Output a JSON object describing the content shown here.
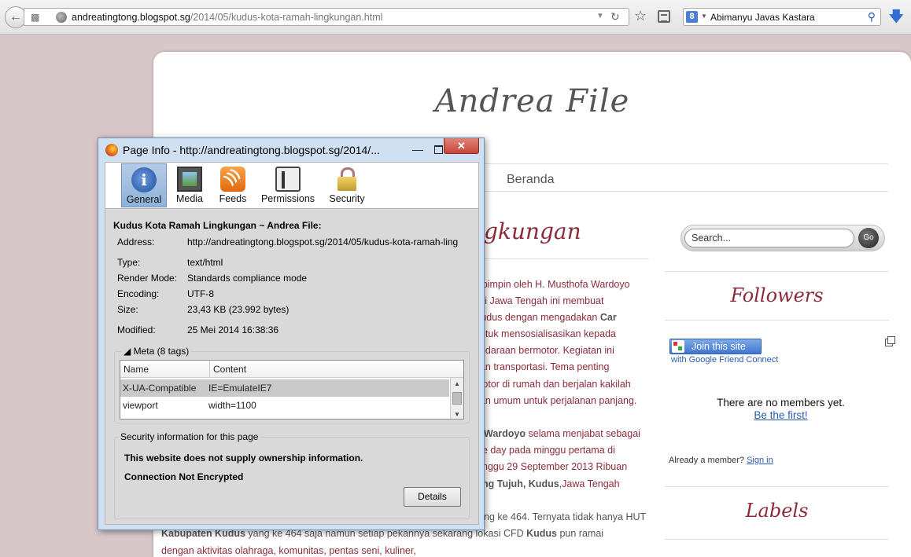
{
  "browser": {
    "url_host": "andreatingtong.blogspot.sg",
    "url_path": "/2014/05/kudus-kota-ramah-lingkungan.html",
    "search_value": "Abimanyu Javas Kastara",
    "search_engine_letter": "8",
    "icons": [
      "back-arrow-icon",
      "history-icon",
      "globe-icon",
      "dropdown-icon",
      "reload-icon",
      "star-icon",
      "bookmarks-icon",
      "search-icon",
      "download-icon"
    ]
  },
  "blog": {
    "title": "Andrea File",
    "nav_home": "Beranda",
    "post_title_visible": "gkungan",
    "post_lines": [
      {
        "text": "dipimpin oleh H. Musthofa Wardoyo",
        "bold": ""
      },
      {
        "text": "l di Jawa Tengah ini membuat",
        "bold": ""
      },
      {
        "text": "Kudus dengan mengadakan ",
        "bold": "Car"
      },
      {
        "text": "untuk mensosialisasikan kepada",
        "bold": ""
      },
      {
        "text": "endaraan bermotor. Kegiatan ini",
        "bold": ""
      },
      {
        "text": "dan transportasi. Tema penting",
        "bold": ""
      },
      {
        "text": "motor di rumah dan berjalan kakilah",
        "bold": ""
      },
      {
        "text": "aan umum untuk perjalanan panjang.",
        "bold": ""
      },
      {
        "text": " selama menjabat sebagai",
        "bold": "Wardoyo"
      },
      {
        "text": "e day pada minggu pertama di",
        "bold": ""
      },
      {
        "text": "nggu 29 September 2013 Ribuan",
        "bold": ""
      },
      {
        "text": "ng Tujuh, ",
        "bold": "Kudus",
        "after": ",Jawa Tengah"
      },
      {
        "text": "ng ke 464. Ternyata tidak hanya HUT",
        "bold": ""
      },
      {
        "text": " yang ke 464 saja namun setiap pekannya sekarang lokasi CFD ",
        "bold": "Kabupaten Kudus",
        "after_bold": "Kudus",
        "tail": " pun ramai"
      },
      {
        "text": "dengan aktivitas olahraga, komunitas, pentas seni, kuliner,",
        "bold": ""
      }
    ],
    "sidebar": {
      "search_placeholder": "Search...",
      "go_label": "Go",
      "followers_heading": "Followers",
      "join_label": "Join this site",
      "gfc_sub": "with Google Friend Connect",
      "no_members": "There are no members yet.",
      "be_first": "Be the first!",
      "already_member": "Already a member?",
      "sign_in": "Sign in",
      "labels_heading": "Labels"
    }
  },
  "dialog": {
    "title": "Page Info - http://andreatingtong.blogspot.sg/2014/...",
    "tabs": [
      {
        "label": "General",
        "icon": "general-icon"
      },
      {
        "label": "Media",
        "icon": "media-icon"
      },
      {
        "label": "Feeds",
        "icon": "feeds-icon"
      },
      {
        "label": "Permissions",
        "icon": "permissions-icon"
      },
      {
        "label": "Security",
        "icon": "security-icon"
      }
    ],
    "heading": "Kudus Kota Ramah Lingkungan ~ Andrea File:",
    "fields": [
      {
        "label": "Address:",
        "value": "http://andreatingtong.blogspot.sg/2014/05/kudus-kota-ramah-ling"
      },
      {
        "label": "Type:",
        "value": "text/html"
      },
      {
        "label": "Render Mode:",
        "value": "Standards compliance mode"
      },
      {
        "label": "Encoding:",
        "value": "UTF-8"
      },
      {
        "label": "Size:",
        "value": "23,43 KB (23.992 bytes)"
      },
      {
        "label": "Modified:",
        "value": "25 Mei 2014 16:38:36"
      }
    ],
    "meta_legend": "◢ Meta (8 tags)",
    "meta_columns": [
      "Name",
      "Content"
    ],
    "meta_rows": [
      {
        "name": "X-UA-Compatible",
        "content": "IE=EmulateIE7"
      },
      {
        "name": "viewport",
        "content": "width=1100"
      }
    ],
    "security_legend": "Security information for this page",
    "security_ownership": "This website does not supply ownership information.",
    "security_connection": "Connection Not Encrypted",
    "details_label": "Details"
  }
}
